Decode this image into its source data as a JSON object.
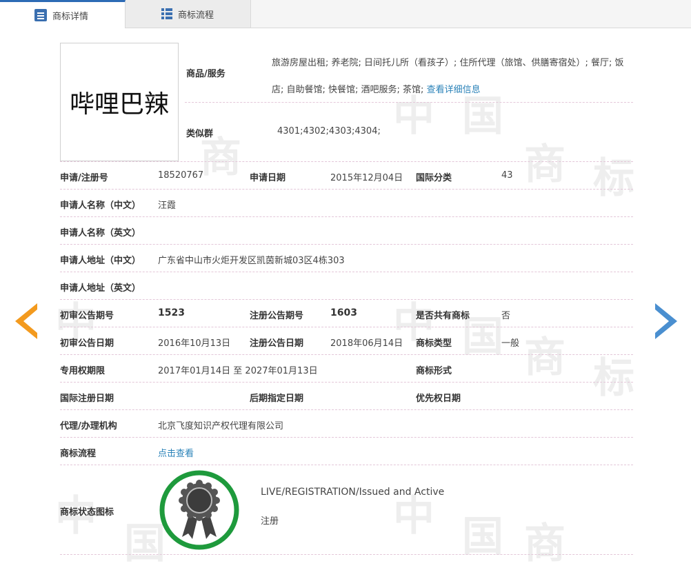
{
  "tabs": {
    "detail": "商标详情",
    "flow": "商标流程"
  },
  "watermark": [
    "中",
    "国",
    "商",
    "标"
  ],
  "trademark_name": "哔哩巴辣",
  "goods": {
    "label": "商品/服务",
    "text": "旅游房屋出租; 养老院; 日间托儿所（看孩子）; 住所代理（旅馆、供膳寄宿处）; 餐厅; 饭店; 自助餐馆; 快餐馆; 酒吧服务; 茶馆;",
    "more_link": "查看详细信息"
  },
  "similar_group": {
    "label": "类似群",
    "value": "4301;4302;4303;4304;"
  },
  "fields": {
    "reg_no_label": "申请/注册号",
    "reg_no": "18520767",
    "app_date_label": "申请日期",
    "app_date": "2015年12月04日",
    "intl_class_label": "国际分类",
    "intl_class": "43",
    "applicant_cn_label": "申请人名称（中文）",
    "applicant_cn": "汪霞",
    "applicant_en_label": "申请人名称（英文）",
    "applicant_en": "",
    "address_cn_label": "申请人地址（中文）",
    "address_cn": "广东省中山市火炬开发区凯茵新城03区4栋303",
    "address_en_label": "申请人地址（英文）",
    "address_en": "",
    "prelim_no_label": "初审公告期号",
    "prelim_no": "1523",
    "reg_pub_no_label": "注册公告期号",
    "reg_pub_no": "1603",
    "shared_label": "是否共有商标",
    "shared": "否",
    "prelim_date_label": "初审公告日期",
    "prelim_date": "2016年10月13日",
    "reg_pub_date_label": "注册公告日期",
    "reg_pub_date": "2018年06月14日",
    "tm_type_label": "商标类型",
    "tm_type": "一般",
    "exclusive_label": "专用权期限",
    "exclusive": "2017年01月14日 至 2027年01月13日",
    "tm_form_label": "商标形式",
    "tm_form": "",
    "intl_reg_date_label": "国际注册日期",
    "later_date_label": "后期指定日期",
    "priority_date_label": "优先权日期",
    "agent_label": "代理/办理机构",
    "agent": "北京飞度知识产权代理有限公司",
    "process_label": "商标流程",
    "process_link": "点击查看",
    "status_label": "商标状态图标",
    "status_en": "LIVE/REGISTRATION/Issued and Active",
    "status_cn": "注册"
  },
  "colors": {
    "accent_blue": "#2d6bb5",
    "link": "#2a82b8",
    "arrow_left": "#f39a1e",
    "arrow_right": "#4a8fd0",
    "status_ring": "#1e9a3c"
  },
  "icons": {
    "detail_tab": "detail-list-icon",
    "flow_tab": "flow-list-icon",
    "prev": "prev-arrow-icon",
    "next": "next-arrow-icon",
    "status": "rosette-medal-icon"
  }
}
